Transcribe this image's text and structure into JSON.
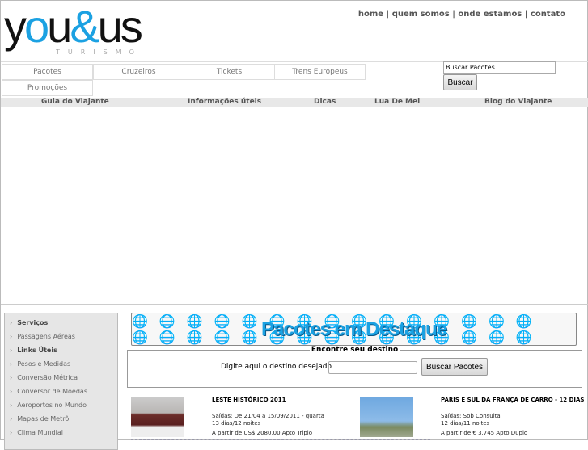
{
  "logo": {
    "main_a": "y",
    "main_o": "o",
    "main_b": "u",
    "amp": "&",
    "main_c": "us",
    "sub": "TURISMO"
  },
  "top_links": [
    "home",
    "quem somos",
    "onde estamos",
    "contato"
  ],
  "tabs": [
    "Pacotes",
    "Cruzeiros",
    "Tickets",
    "Trens Europeus",
    "Promoções"
  ],
  "search": {
    "value": "Buscar Pacotes",
    "button": "Buscar"
  },
  "nav": [
    "Guia do Viajante",
    "Informações úteis",
    "Dicas",
    "Lua De Mel",
    "Blog do Viajante"
  ],
  "sidebar": [
    {
      "label": "Serviços",
      "bold": true
    },
    {
      "label": "Passagens Aéreas"
    },
    {
      "label": "Links Úteis",
      "bold": true
    },
    {
      "label": "Pesos e Medidas"
    },
    {
      "label": "Conversão Métrica"
    },
    {
      "label": "Conversor de Moedas"
    },
    {
      "label": "Aeroportos no Mundo"
    },
    {
      "label": "Mapas de Metrô"
    },
    {
      "label": "Clima Mundial"
    }
  ],
  "banner": {
    "title": "Pacotes em Destaque"
  },
  "finder": {
    "legend": "Encontre seu destino",
    "label": "Digite aqui o destino desejado",
    "button": "Buscar Pacotes"
  },
  "packages": [
    {
      "title": "LESTE HISTÓRICO 2011",
      "line1": "Saídas: De 21/04 a 15/09/2011 - quarta",
      "line2": "13 dias/12 noites",
      "price": "A partir de US$ 2080,00 Apto Triplo"
    },
    {
      "title": "PARIS E SUL DA FRANÇA DE CARRO - 12 DIAS",
      "line1": "Saídas: Sob Consulta",
      "line2": "12 dias/11 noites",
      "price": "A partir de € 3.745 Apto.Duplo"
    }
  ]
}
